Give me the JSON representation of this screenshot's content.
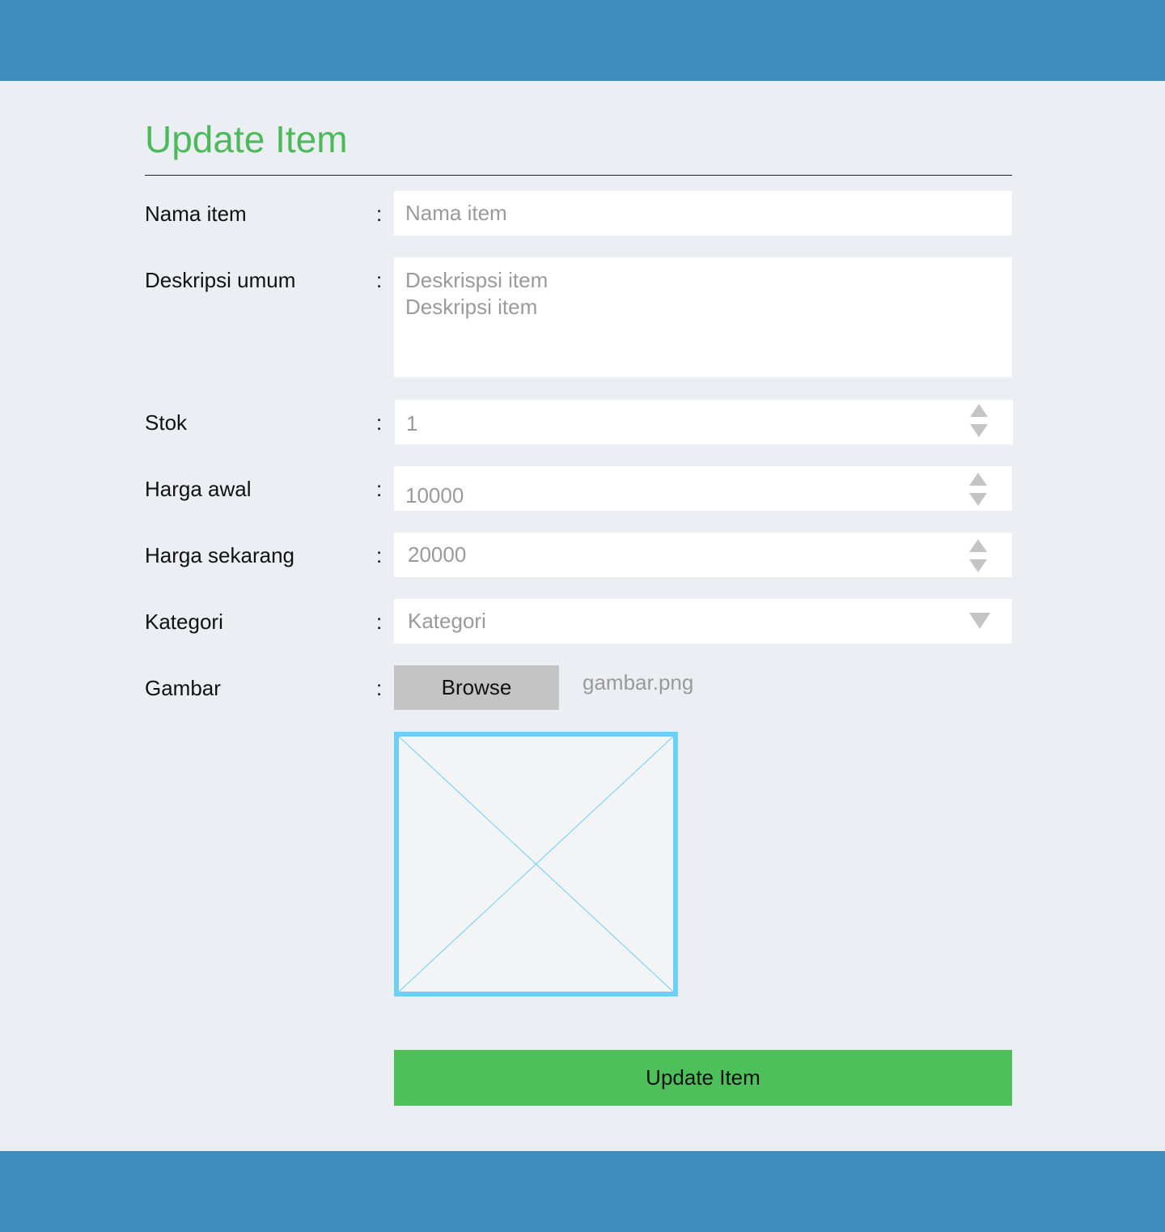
{
  "form": {
    "title": "Update Item",
    "separator": ":",
    "fields": {
      "nama_item": {
        "label": "Nama item",
        "placeholder": "Nama item"
      },
      "deskripsi": {
        "label": "Deskripsi umum",
        "lines": [
          "Deskrispsi item",
          "Deskripsi item"
        ]
      },
      "stok": {
        "label": "Stok",
        "value": "1"
      },
      "harga_awal": {
        "label": "Harga awal",
        "value": "10000"
      },
      "harga_sekarang": {
        "label": "Harga sekarang",
        "value": "20000"
      },
      "kategori": {
        "label": "Kategori",
        "placeholder": "Kategori"
      },
      "gambar": {
        "label": "Gambar",
        "browse_label": "Browse",
        "file_name": "gambar.png"
      }
    },
    "submit_label": "Update Item"
  },
  "colors": {
    "header_bar": "#3c8dbc",
    "title": "#4cba5a",
    "submit": "#4fbf5b",
    "image_border": "#6bcff6"
  },
  "icons": {
    "spinner": "spinner-arrows-icon",
    "dropdown": "chevron-down-icon",
    "image_placeholder": "image-placeholder-icon"
  }
}
